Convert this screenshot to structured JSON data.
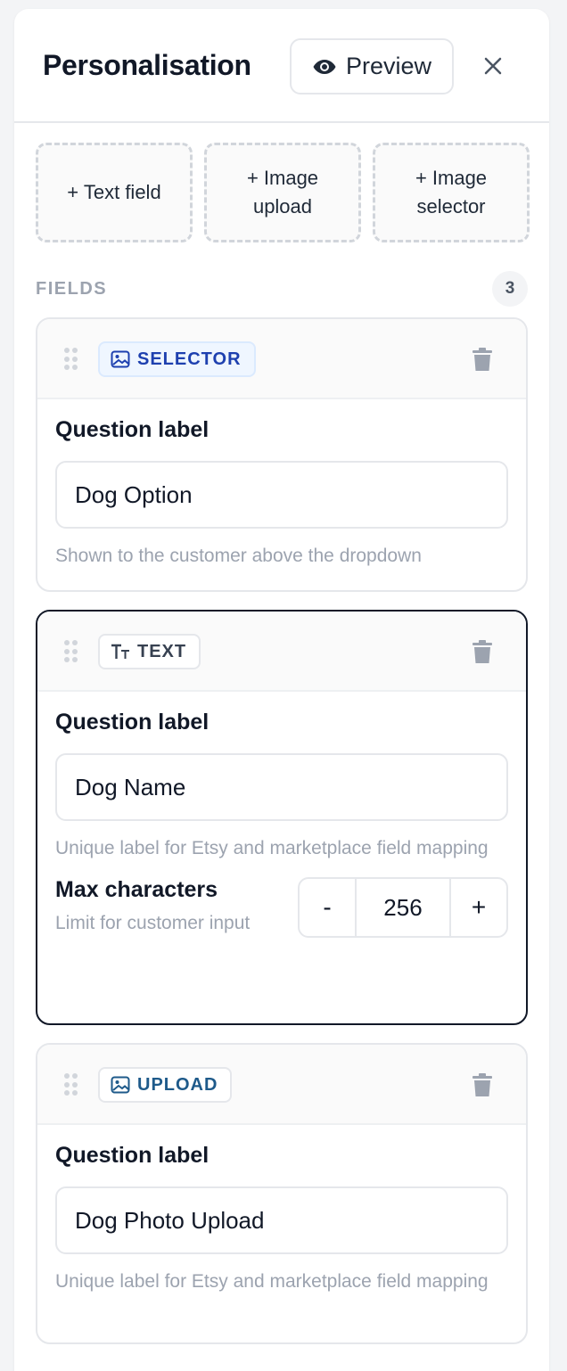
{
  "header": {
    "title": "Personalisation",
    "preview_label": "Preview"
  },
  "add_buttons": [
    "+ Text field",
    "+ Image upload",
    "+ Image selector"
  ],
  "fields_section": {
    "label": "FIELDS",
    "count": "3"
  },
  "fields": [
    {
      "tag": "SELECTOR",
      "question_title": "Question label",
      "value": "Dog Option",
      "hint": "Shown to the customer above the dropdown"
    },
    {
      "tag": "TEXT",
      "question_title": "Question label",
      "value": "Dog Name",
      "hint": "Unique label for Etsy and marketplace field mapping",
      "max_title": "Max characters",
      "max_hint": "Limit for customer input",
      "max_value": "256",
      "minus": "-",
      "plus": "+"
    },
    {
      "tag": "UPLOAD",
      "question_title": "Question label",
      "value": "Dog Photo Upload",
      "hint": "Unique label for Etsy and marketplace field mapping"
    }
  ],
  "colors": {
    "selector_tag": "#1e40af",
    "upload_tag": "#1e5a8a",
    "active_border": "#111827"
  },
  "icons": [
    "eye-icon",
    "close-icon",
    "drag-handle-icon",
    "image-icon",
    "text-size-icon",
    "trash-icon"
  ]
}
